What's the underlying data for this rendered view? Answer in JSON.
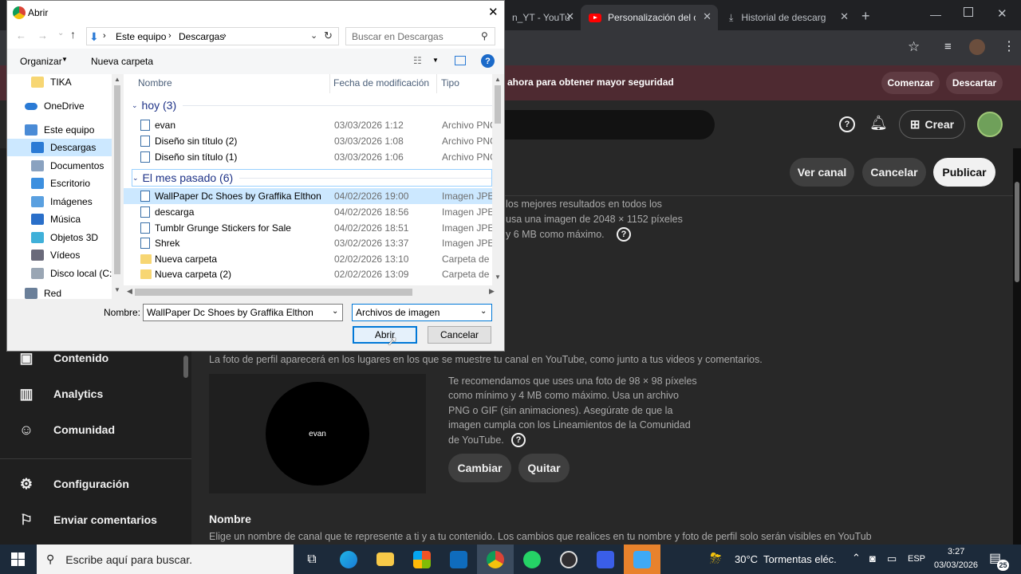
{
  "browser": {
    "tabs": [
      {
        "label": "n_YT - YouTu"
      },
      {
        "label": "Personalización del ca"
      },
      {
        "label": "Historial de descarg"
      }
    ],
    "new_tab": "+"
  },
  "infobar": {
    "message": "ahora para obtener mayor seguridad",
    "start_label": "Comenzar",
    "dismiss_label": "Descartar"
  },
  "yt_header": {
    "create_label": "Crear"
  },
  "actions": {
    "view_channel": "Ver canal",
    "cancel": "Cancelar",
    "publish": "Publicar"
  },
  "banner_text": {
    "line1": "los mejores resultados en todos los",
    "line2": "usa una imagen de 2048 × 1152 píxeles",
    "line3": "y 6 MB como máximo."
  },
  "sidebar": {
    "items": [
      {
        "label": "Contenido",
        "icon": "content-icon"
      },
      {
        "label": "Analytics",
        "icon": "analytics-icon"
      },
      {
        "label": "Comunidad",
        "icon": "community-icon"
      },
      {
        "label": "Configuración",
        "icon": "gear-icon"
      },
      {
        "label": "Enviar comentarios",
        "icon": "feedback-icon"
      }
    ]
  },
  "profile": {
    "description": "La foto de perfil aparecerá en los lugares en los que se muestre tu canal en YouTube, como junto a tus videos y comentarios.",
    "avatar_text": "evan",
    "rec_line1": "Te recomendamos que uses una foto de 98 × 98 píxeles",
    "rec_line2": "como mínimo y 4 MB como máximo. Usa un archivo",
    "rec_line3": "PNG o GIF (sin animaciones). Asegúrate de que la",
    "rec_line4": "imagen cumpla con los Lineamientos de la Comunidad",
    "rec_line5": "de YouTube.",
    "change_label": "Cambiar",
    "remove_label": "Quitar"
  },
  "name_section": {
    "title": "Nombre",
    "description": "Elige un nombre de canal que te represente a ti y a tu contenido. Los cambios que realices en tu nombre y foto de perfil solo serán visibles en YouTube y"
  },
  "dialog": {
    "title": "Abrir",
    "breadcrumb": [
      "Este equipo",
      "Descargas"
    ],
    "search_placeholder": "Buscar en Descargas",
    "organize": "Organizar",
    "new_folder": "Nueva carpeta",
    "columns": {
      "name": "Nombre",
      "date": "Fecha de modificación",
      "type": "Tipo"
    },
    "nav": [
      {
        "label": "TIKA",
        "color": "#f7d673"
      },
      {
        "label": "OneDrive",
        "color": "#2a7ad5"
      },
      {
        "label": "Este equipo",
        "color": "#4a8bd6"
      },
      {
        "label": "Descargas",
        "color": "#2a7ad5"
      },
      {
        "label": "Documentos",
        "color": "#8aa2c0"
      },
      {
        "label": "Escritorio",
        "color": "#3c8fdf"
      },
      {
        "label": "Imágenes",
        "color": "#5aa0e0"
      },
      {
        "label": "Música",
        "color": "#2a6fc9"
      },
      {
        "label": "Objetos 3D",
        "color": "#3fb0d9"
      },
      {
        "label": "Vídeos",
        "color": "#6a6a7a"
      },
      {
        "label": "Disco local (C:)",
        "color": "#9aa6b4"
      },
      {
        "label": "Red",
        "color": "#6a7f99"
      }
    ],
    "groups": [
      {
        "label": "hoy (3)",
        "files": [
          {
            "name": "evan",
            "date": "03/03/2026 1:12",
            "type": "Archivo PNG",
            "kind": "file"
          },
          {
            "name": "Diseño sin título (2)",
            "date": "03/03/2026 1:08",
            "type": "Archivo PNG",
            "kind": "file"
          },
          {
            "name": "Diseño sin título (1)",
            "date": "03/03/2026 1:06",
            "type": "Archivo PNG",
            "kind": "file"
          }
        ]
      },
      {
        "label": "El mes pasado (6)",
        "files": [
          {
            "name": "WallPaper Dc Shoes by Graffika Elthon",
            "date": "04/02/2026 19:00",
            "type": "Imagen JPEG",
            "kind": "file"
          },
          {
            "name": "descarga",
            "date": "04/02/2026 18:56",
            "type": "Imagen JPEG",
            "kind": "file"
          },
          {
            "name": "Tumblr Grunge Stickers for Sale",
            "date": "04/02/2026 18:51",
            "type": "Imagen JPEG",
            "kind": "file"
          },
          {
            "name": "Shrek",
            "date": "03/02/2026 13:37",
            "type": "Imagen JPEG",
            "kind": "file"
          },
          {
            "name": "Nueva carpeta",
            "date": "02/02/2026 13:10",
            "type": "Carpeta de ar",
            "kind": "folder"
          },
          {
            "name": "Nueva carpeta (2)",
            "date": "02/02/2026 13:09",
            "type": "Carpeta de ar",
            "kind": "folder"
          }
        ]
      }
    ],
    "filename_label": "Nombre:",
    "filename_value": "WallPaper Dc Shoes by Graffika Elthon",
    "filetype_value": "Archivos de imagen",
    "open_label": "Abrir",
    "cancel_label": "Cancelar"
  },
  "taskbar": {
    "search_placeholder": "Escribe aquí para buscar.",
    "weather": "30°C  Tormentas eléc.",
    "lang": "ESP",
    "time": "3:27",
    "date": "03/03/2026",
    "notif_count": "25"
  }
}
